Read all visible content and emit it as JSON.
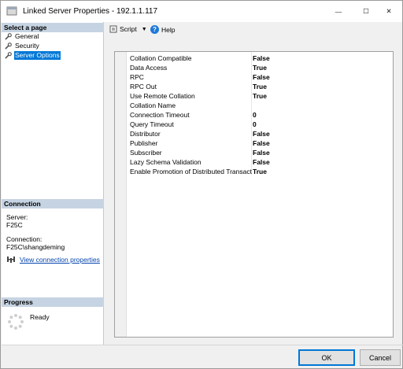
{
  "window": {
    "title": "Linked Server Properties - 192.1.1.117",
    "minimize_glyph": "—",
    "maximize_glyph": "☐",
    "close_glyph": "✕"
  },
  "left_pane": {
    "select_page_header": "Select a page",
    "pages": [
      {
        "label": "General",
        "selected": false
      },
      {
        "label": "Security",
        "selected": false
      },
      {
        "label": "Server Options",
        "selected": true
      }
    ],
    "connection_header": "Connection",
    "server_label": "Server:",
    "server_value": "F25C",
    "connection_label": "Connection:",
    "connection_value": "F25C\\shangdeming",
    "view_connection_link": "View connection properties",
    "progress_header": "Progress",
    "progress_status": "Ready"
  },
  "toolbar": {
    "script_label": "Script",
    "script_caret": "▼",
    "help_glyph": "?",
    "help_label": "Help"
  },
  "properties": [
    {
      "name": "Collation Compatible",
      "value": "False"
    },
    {
      "name": "Data Access",
      "value": "True"
    },
    {
      "name": "RPC",
      "value": "False"
    },
    {
      "name": "RPC Out",
      "value": "True"
    },
    {
      "name": "Use Remote Collation",
      "value": "True"
    },
    {
      "name": "Collation Name",
      "value": ""
    },
    {
      "name": "Connection Timeout",
      "value": "0"
    },
    {
      "name": "Query Timeout",
      "value": "0"
    },
    {
      "name": "Distributor",
      "value": "False"
    },
    {
      "name": "Publisher",
      "value": "False"
    },
    {
      "name": "Subscriber",
      "value": "False"
    },
    {
      "name": "Lazy Schema Validation",
      "value": "False"
    },
    {
      "name": "Enable Promotion of Distributed Transaction",
      "value": "True"
    }
  ],
  "buttons": {
    "ok": "OK",
    "cancel": "Cancel"
  },
  "colors": {
    "selected_bg": "#0078d7",
    "pane_header_bg": "#c6d3e2",
    "link": "#0645ad"
  }
}
